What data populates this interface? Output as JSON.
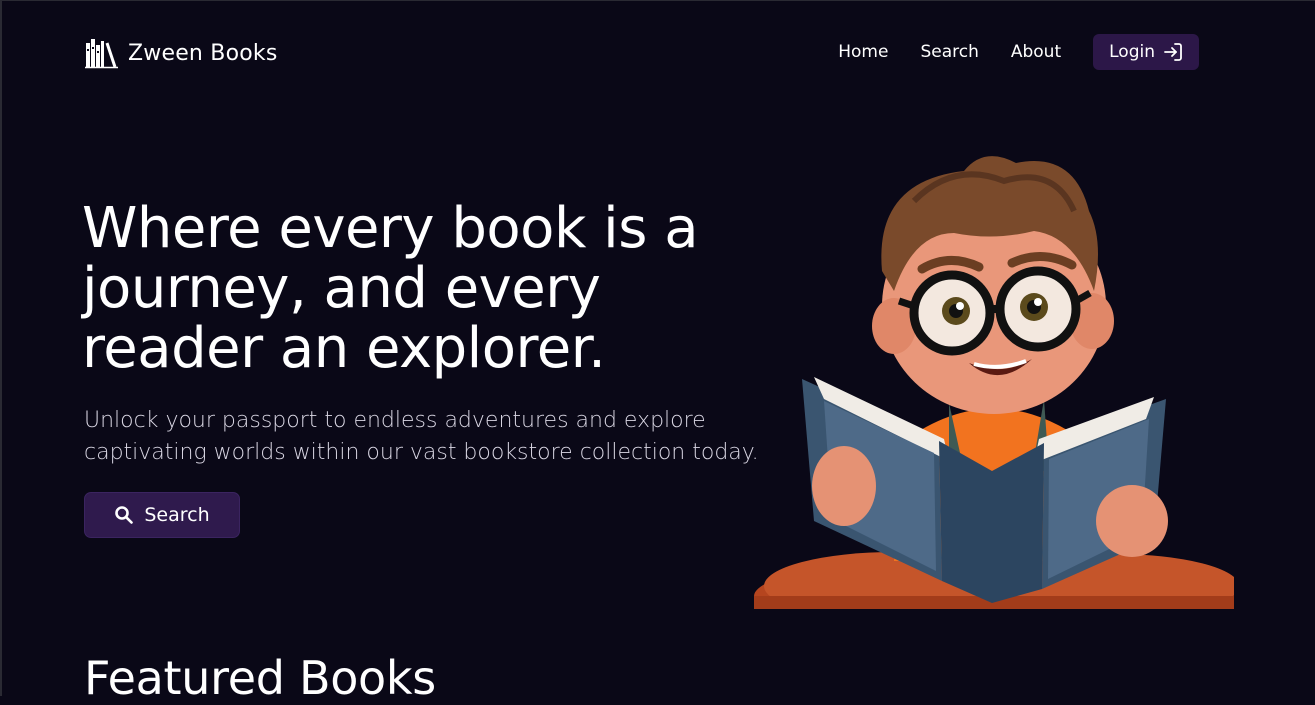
{
  "header": {
    "brand_name": "Zween Books",
    "brand_icon": "books-icon",
    "nav": {
      "home": "Home",
      "search": "Search",
      "about": "About",
      "login": "Login"
    }
  },
  "hero": {
    "title": "Where every book is a journey, and every reader an explorer.",
    "subtitle": "Unlock your passport to endless adventures and explore captivating worlds within our vast bookstore collection today.",
    "search_button": "Search",
    "illustration": "boy-reading-book-illustration"
  },
  "featured": {
    "title": "Featured Books"
  },
  "colors": {
    "background": "#0a0817",
    "button": "#2c1748",
    "text": "#ffffff"
  }
}
